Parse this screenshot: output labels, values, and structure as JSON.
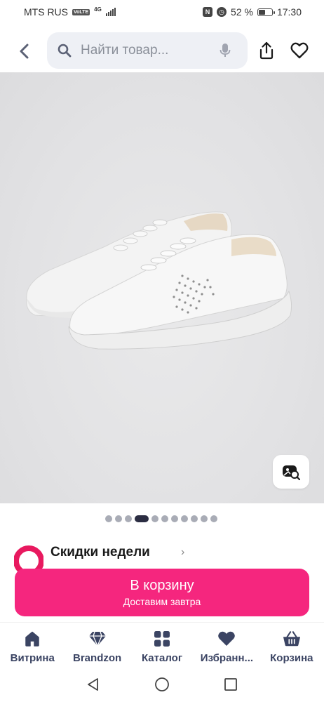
{
  "status_bar": {
    "carrier": "MTS RUS",
    "volte": "VoLTE",
    "network": "4G",
    "battery_percent": "52 %",
    "battery_level": 0.52,
    "time": "17:30"
  },
  "header": {
    "search_placeholder": "Найти товар..."
  },
  "product": {
    "image_count": 11,
    "active_image_index": 3
  },
  "promo": {
    "title": "Скидки недели",
    "chevron": "›"
  },
  "cart_button": {
    "label": "В корзину",
    "sublabel": "Доставим завтра"
  },
  "bottom_nav": {
    "items": [
      {
        "label": "Витрина",
        "icon": "home-icon"
      },
      {
        "label": "Brandzon",
        "icon": "diamond-icon"
      },
      {
        "label": "Каталог",
        "icon": "grid-icon"
      },
      {
        "label": "Избранн...",
        "icon": "heart-icon"
      },
      {
        "label": "Корзина",
        "icon": "basket-icon"
      }
    ]
  },
  "colors": {
    "accent": "#f5267e",
    "nav_icon": "#3b4463",
    "search_bg": "#eef0f5"
  }
}
